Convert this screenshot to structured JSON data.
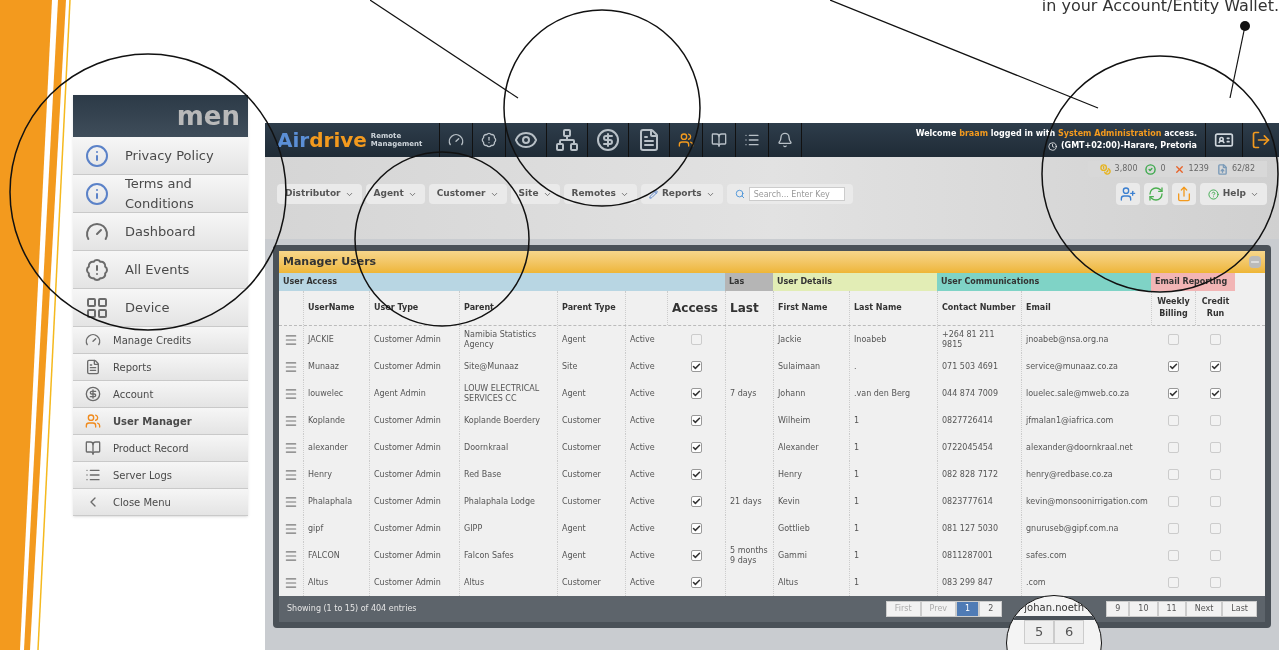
{
  "caption": "in your Account/Entity Wallet.",
  "side_menu": {
    "title": "men",
    "items": [
      {
        "label": "Privacy Policy",
        "kind": "magnified",
        "selected": false
      },
      {
        "label": "Terms and Conditions",
        "kind": "magnified",
        "selected": false
      },
      {
        "label": "Dashboard",
        "kind": "magnified",
        "selected": false
      },
      {
        "label": "All Events",
        "kind": "magnified",
        "selected": false
      },
      {
        "label": "Device",
        "kind": "magnified",
        "selected": false
      },
      {
        "label": "Manage Credits",
        "kind": "normal",
        "selected": false
      },
      {
        "label": "Reports",
        "kind": "normal",
        "selected": false
      },
      {
        "label": "Account",
        "kind": "normal",
        "selected": false
      },
      {
        "label": "User Manager",
        "kind": "normal",
        "selected": true
      },
      {
        "label": "Product Record",
        "kind": "normal",
        "selected": false
      },
      {
        "label": "Server Logs",
        "kind": "normal",
        "selected": false
      },
      {
        "label": "Close Menu",
        "kind": "normal",
        "selected": false
      }
    ]
  },
  "header": {
    "logo_a": "Air",
    "logo_b": "drive",
    "tagline": "Remote Management",
    "nav": [
      {
        "kind": "normal",
        "selected": false
      },
      {
        "kind": "normal",
        "selected": false
      },
      {
        "kind": "magnified",
        "selected": false
      },
      {
        "kind": "magnified",
        "selected": false
      },
      {
        "kind": "magnified",
        "selected": false
      },
      {
        "kind": "magnified",
        "selected": false
      },
      {
        "kind": "normal",
        "selected": true
      },
      {
        "kind": "normal",
        "selected": false
      },
      {
        "kind": "normal",
        "selected": false
      },
      {
        "kind": "normal",
        "selected": false
      }
    ],
    "welcome": [
      {
        "text": "Welcome",
        "highlight": false
      },
      {
        "text": "braam",
        "highlight": true
      },
      {
        "text": "logged in with",
        "highlight": false
      },
      {
        "text": "System Administration",
        "highlight": true
      },
      {
        "text": "access.",
        "highlight": false
      }
    ],
    "timezone": "(GMT+02:00)-Harare, Pretoria"
  },
  "stats": [
    "3,800",
    "0",
    "1239",
    "62/82"
  ],
  "filters": [
    "Distributor",
    "Agent",
    "Customer",
    "Site",
    "Remotes"
  ],
  "reports_button": "Reports",
  "search": {
    "placeholder": "Search... Enter Key"
  },
  "help_button": "Help",
  "panel": {
    "title": "Manager Users",
    "groups": [
      {
        "label": "User Access",
        "color": "#b8d6e3"
      },
      {
        "label": "Las",
        "color": "#b5b5b5"
      },
      {
        "label": "User Details",
        "color": "#e2edb5"
      },
      {
        "label": "User Communications",
        "color": "#7fd3c6"
      },
      {
        "label": "Email Reporting",
        "color": "#f2b5b5"
      }
    ],
    "columns": [
      "UserName",
      "User Type",
      "Parent",
      "Parent Type",
      "",
      "Access",
      "Last",
      "First Name",
      "Last Name",
      "Contact Number",
      "Email",
      "Weekly Billing",
      "Credit Run"
    ],
    "rows": [
      {
        "cells": [
          "JACKIE",
          "Customer Admin",
          "Namibia Statistics Agency",
          "Agent",
          "Active",
          "",
          "",
          "Jackie",
          "Inoabeb",
          "+264 81 211 9815",
          "jnoabeb@nsa.org.na"
        ],
        "access": false,
        "weekly": false,
        "credit": false
      },
      {
        "cells": [
          "Munaaz",
          "Customer Admin",
          "Site@Munaaz",
          "Site",
          "Active",
          "",
          "",
          "Sulaimaan",
          ".",
          "071 503 4691",
          "service@munaaz.co.za"
        ],
        "access": true,
        "weekly": true,
        "credit": true
      },
      {
        "cells": [
          "louwelec",
          "Agent Admin",
          "LOUW ELECTRICAL SERVICES CC",
          "Agent",
          "Active",
          "",
          "7 days",
          "Johann",
          ".van den Berg",
          "044 874 7009",
          "louelec.sale@mweb.co.za"
        ],
        "access": true,
        "weekly": true,
        "credit": true
      },
      {
        "cells": [
          "Koplande",
          "Customer Admin",
          "Koplande Boerdery",
          "Customer",
          "Active",
          "",
          "",
          "Wilheim",
          "1",
          "0827726414",
          "jfmalan1@iafrica.com"
        ],
        "access": true,
        "weekly": false,
        "credit": false
      },
      {
        "cells": [
          "alexander",
          "Customer Admin",
          "Doornkraal",
          "Customer",
          "Active",
          "",
          "",
          "Alexander",
          "1",
          "0722045454",
          "alexander@doornkraal.net"
        ],
        "access": true,
        "weekly": false,
        "credit": false
      },
      {
        "cells": [
          "Henry",
          "Customer Admin",
          "Red Base",
          "Customer",
          "Active",
          "",
          "",
          "Henry",
          "1",
          "082 828 7172",
          "henry@redbase.co.za"
        ],
        "access": true,
        "weekly": false,
        "credit": false
      },
      {
        "cells": [
          "Phalaphala",
          "Customer Admin",
          "Phalaphala Lodge",
          "Customer",
          "Active",
          "",
          "21 days",
          "Kevin",
          "1",
          "0823777614",
          "kevin@monsoonirrigation.com"
        ],
        "access": true,
        "weekly": false,
        "credit": false
      },
      {
        "cells": [
          "gipf",
          "Customer Admin",
          "GIPP",
          "Agent",
          "Active",
          "",
          "",
          "Gottlieb",
          "1",
          "081 127 5030",
          "gnuruseb@gipf.com.na"
        ],
        "access": true,
        "weekly": false,
        "credit": false
      },
      {
        "cells": [
          "FALCON",
          "Customer Admin",
          "Falcon Safes",
          "Agent",
          "Active",
          "",
          "5 months 9 days",
          "Gammi",
          "1",
          "0811287001",
          "safes.com"
        ],
        "access": true,
        "weekly": false,
        "credit": false
      },
      {
        "cells": [
          "Altus",
          "Customer Admin",
          "Altus",
          "Customer",
          "Active",
          "",
          "",
          "Altus",
          "1",
          "083 299 847",
          ".com"
        ],
        "access": true,
        "weekly": false,
        "credit": false
      }
    ],
    "footer": "Showing (1 to 15) of 404 entries",
    "pages": [
      {
        "label": "First",
        "selected": false,
        "disabled": true
      },
      {
        "label": "Prev",
        "selected": false,
        "disabled": true
      },
      {
        "label": "1",
        "selected": true,
        "disabled": false
      },
      {
        "label": "2",
        "selected": false,
        "disabled": false
      },
      {
        "label": "9",
        "selected": false,
        "disabled": false
      },
      {
        "label": "10",
        "selected": false,
        "disabled": false
      },
      {
        "label": "11",
        "selected": false,
        "disabled": false
      },
      {
        "label": "Next",
        "selected": false,
        "disabled": false
      },
      {
        "label": "Last",
        "selected": false,
        "disabled": false
      }
    ],
    "zoom": {
      "text": "johan.noeth",
      "pages": [
        "5",
        "6"
      ]
    }
  }
}
